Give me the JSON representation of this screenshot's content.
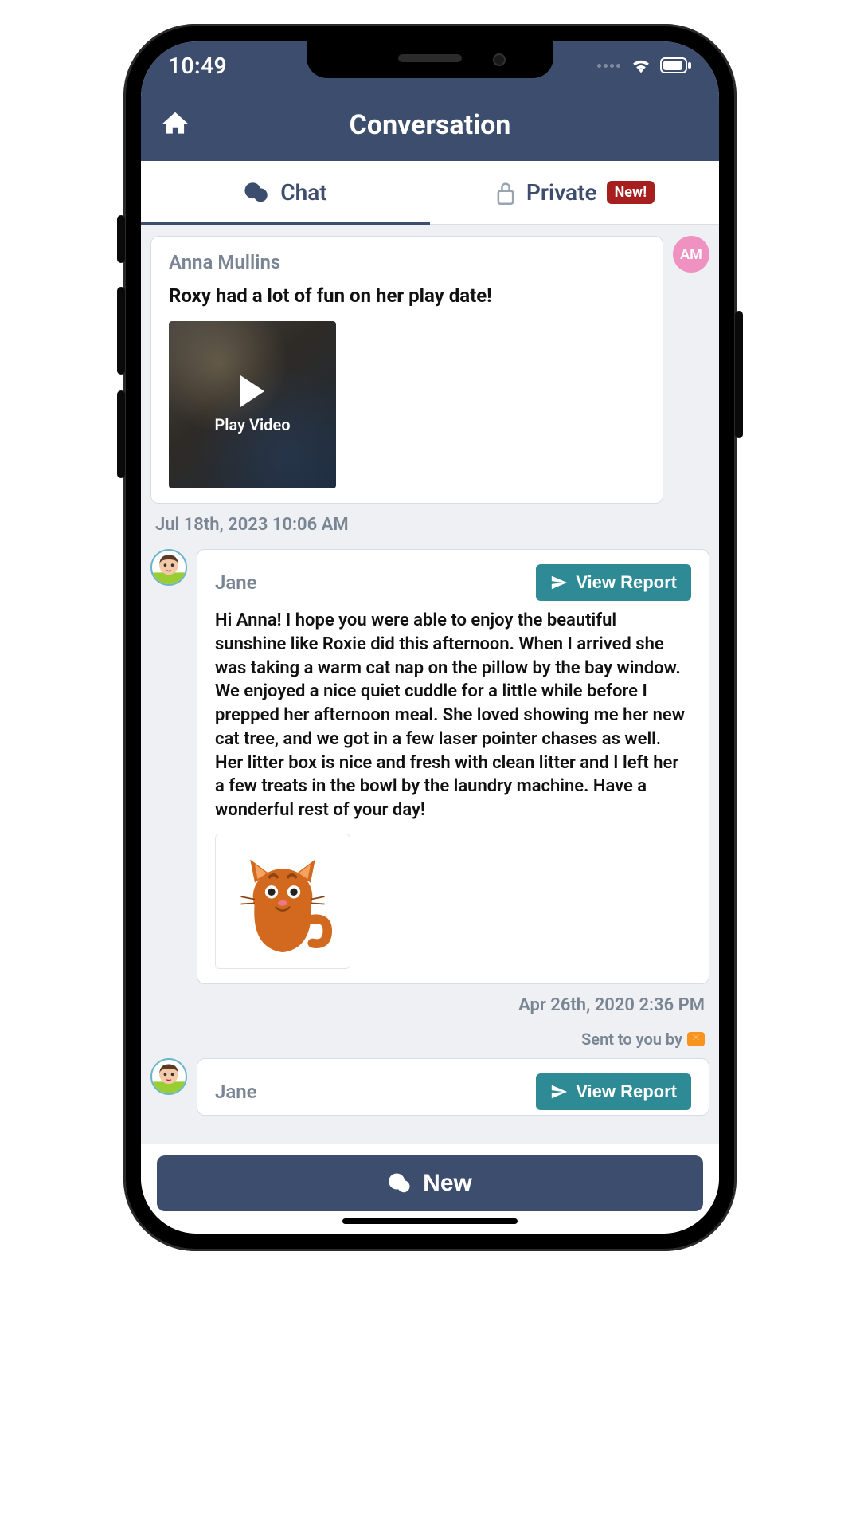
{
  "status": {
    "time": "10:49"
  },
  "header": {
    "title": "Conversation"
  },
  "tabs": {
    "chat_label": "Chat",
    "private_label": "Private",
    "new_badge": "New!"
  },
  "messages": [
    {
      "sender": "Anna Mullins",
      "avatar_initials": "AM",
      "text": "Roxy had a lot of fun on her play date!",
      "video_label": "Play Video",
      "timestamp": "Jul 18th, 2023 10:06 AM"
    },
    {
      "sender": "Jane",
      "report_button": "View Report",
      "body": "Hi Anna! I hope you were able to enjoy the beautiful sunshine like Roxie did this afternoon. When I arrived she was taking a warm cat nap on the pillow by the bay window. We enjoyed a nice quiet cuddle for a little while before I prepped her afternoon meal. She loved showing me her new cat tree, and we got in a few laser pointer chases as well. Her litter box is nice and fresh with clean litter and I left her a few treats in the bowl by the laundry machine. Have a wonderful rest of your day!",
      "timestamp": "Apr 26th, 2020 2:36 PM",
      "sent_by_label": "Sent to you by"
    },
    {
      "sender": "Jane",
      "report_button": "View Report"
    }
  ],
  "compose": {
    "new_label": "New"
  }
}
